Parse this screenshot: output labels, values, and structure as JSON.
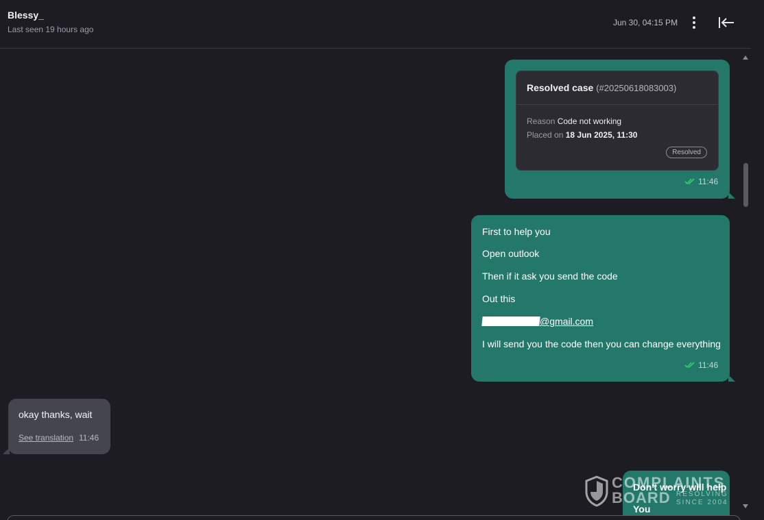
{
  "header": {
    "contact_name": "Blessy_",
    "last_seen": "Last seen 19 hours ago",
    "date": "Jun 30, 04:15 PM"
  },
  "messages": {
    "case_card": {
      "title": "Resolved case",
      "case_number": "(#20250618083003)",
      "reason_label": "Reason",
      "reason_value": "Code not working",
      "placed_label": "Placed on",
      "placed_value": "18 Jun 2025, 11:30",
      "status_badge": "Resolved",
      "time": "11:46"
    },
    "outgoing_1": {
      "lines": [
        "First to help you",
        "Open outlook",
        "Then if it ask you send the code",
        "Out this",
        "@gmail.com",
        "I will send you the code then you can change everything"
      ],
      "time": "11:46"
    },
    "incoming_1": {
      "text": "okay thanks, wait",
      "translation_link": "See translation",
      "time": "11:46"
    },
    "outgoing_2": {
      "lines": [
        "Don't worry will help",
        "You"
      ]
    }
  },
  "watermark": {
    "line1": "COMPLAINTS",
    "line2": "BOARD",
    "sub1": "RESOLVING",
    "sub2": "SINCE 2004"
  },
  "colors": {
    "background": "#1c1c22",
    "outgoing_bubble": "#24786a",
    "incoming_bubble": "#45454e",
    "read_ticks": "#2fd46a"
  },
  "icons": [
    "more-vertical-icon",
    "collapse-left-icon",
    "double-check-icon",
    "shield-logo-icon"
  ]
}
